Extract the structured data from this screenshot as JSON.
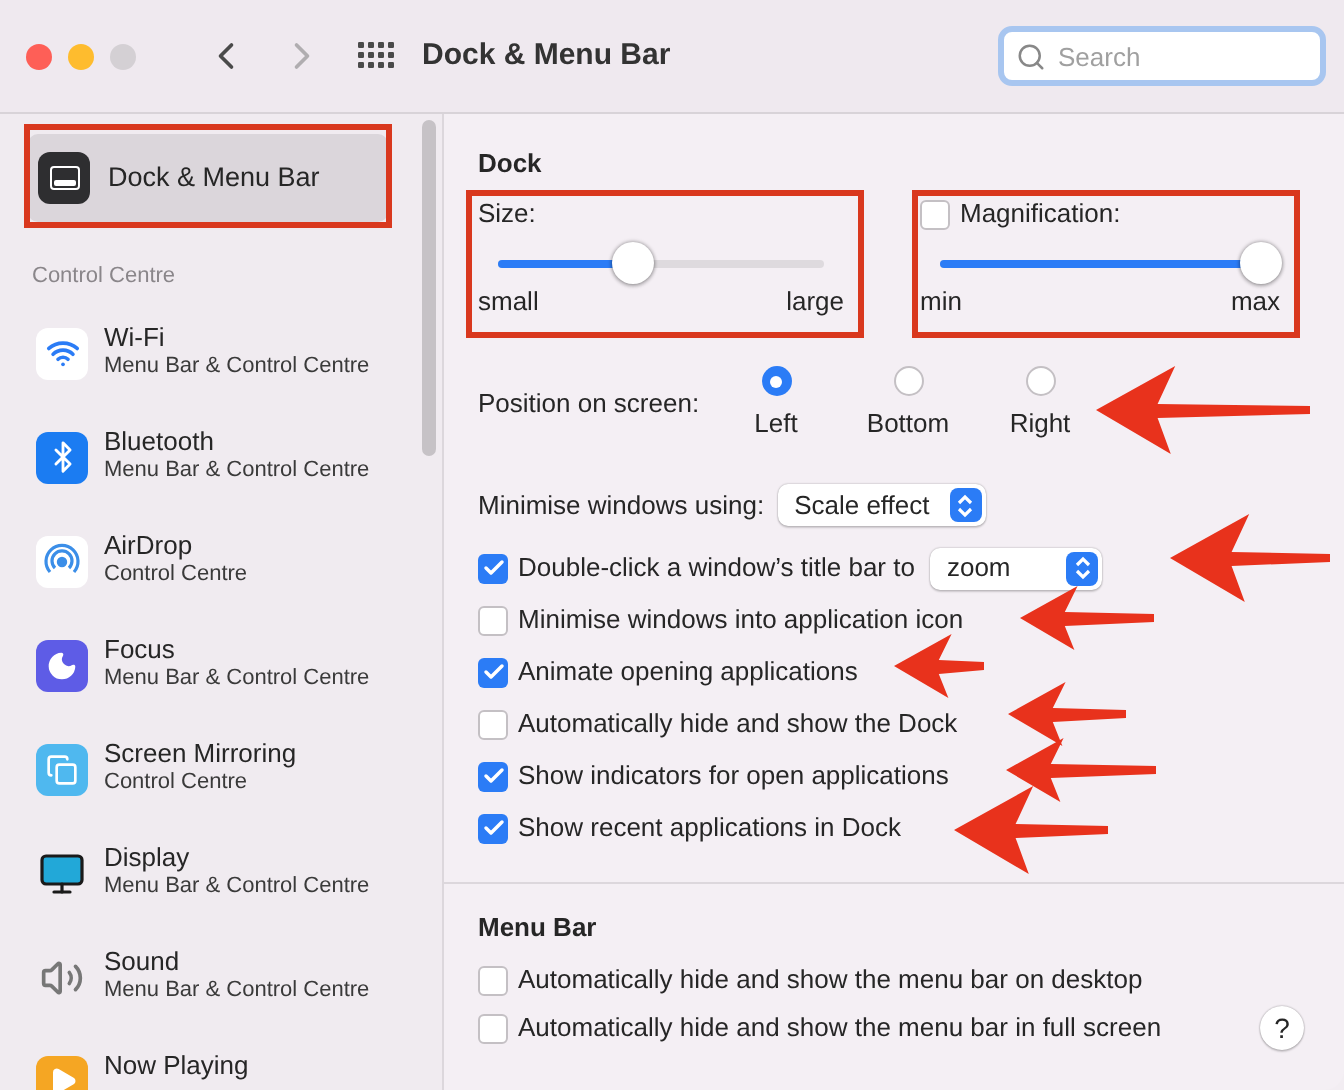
{
  "window": {
    "title": "Dock & Menu Bar",
    "controls": [
      {
        "kind": "close",
        "disabled": false
      },
      {
        "kind": "minimize",
        "disabled": false
      },
      {
        "kind": "zoom",
        "disabled": true
      }
    ],
    "back": {
      "disabled": false
    },
    "forward": {
      "disabled": true
    }
  },
  "search": {
    "placeholder": "Search"
  },
  "sidebar": {
    "top_item": {
      "label": "Dock & Menu Bar",
      "kind": "dock",
      "selected": true
    },
    "section": "Control Centre",
    "items": [
      {
        "label": "Wi-Fi",
        "subtitle": "Menu Bar & Control Centre",
        "kind": "wifi",
        "selected": false
      },
      {
        "label": "Bluetooth",
        "subtitle": "Menu Bar & Control Centre",
        "kind": "bluetooth",
        "selected": false
      },
      {
        "label": "AirDrop",
        "subtitle": "Control Centre",
        "kind": "airdrop",
        "selected": false
      },
      {
        "label": "Focus",
        "subtitle": "Menu Bar & Control Centre",
        "kind": "focus",
        "selected": false
      },
      {
        "label": "Screen Mirroring",
        "subtitle": "Control Centre",
        "kind": "mirroring",
        "selected": false
      },
      {
        "label": "Display",
        "subtitle": "Menu Bar & Control Centre",
        "kind": "display",
        "selected": false
      },
      {
        "label": "Sound",
        "subtitle": "Menu Bar & Control Centre",
        "kind": "sound",
        "selected": false
      },
      {
        "label": "Now Playing",
        "kind": "nowplaying",
        "selected": false
      }
    ]
  },
  "dock": {
    "title": "Dock",
    "size": {
      "label": "Size:",
      "level": 0.41,
      "min_label": "small",
      "max_label": "large"
    },
    "magnification": {
      "label": "Magnification:",
      "checked": false,
      "level": 1,
      "min_label": "min",
      "max_label": "max"
    },
    "position": {
      "label": "Position on screen:",
      "options": [
        {
          "label": "Left",
          "selected": true
        },
        {
          "label": "Bottom",
          "selected": false
        },
        {
          "label": "Right",
          "selected": false
        }
      ]
    },
    "minimise": {
      "label": "Minimise windows using:",
      "value": "Scale effect"
    },
    "options": [
      {
        "kind": "checkbox_select",
        "label": "Double-click a window’s title bar to",
        "checked": true,
        "value": "zoom"
      },
      {
        "kind": "checkbox",
        "label": "Minimise windows into application icon",
        "checked": false
      },
      {
        "kind": "checkbox",
        "label": "Animate opening applications",
        "checked": true
      },
      {
        "kind": "checkbox",
        "label": "Automatically hide and show the Dock",
        "checked": false
      },
      {
        "kind": "checkbox",
        "label": "Show indicators for open applications",
        "checked": true
      },
      {
        "kind": "checkbox",
        "label": "Show recent applications in Dock",
        "checked": true
      }
    ]
  },
  "menu_bar": {
    "title": "Menu Bar",
    "options": [
      {
        "kind": "checkbox",
        "label": "Automatically hide and show the menu bar on desktop",
        "checked": false
      },
      {
        "kind": "checkbox",
        "label": "Automatically hide and show the menu bar in full screen",
        "checked": false
      }
    ]
  },
  "help": {
    "label": "?"
  }
}
